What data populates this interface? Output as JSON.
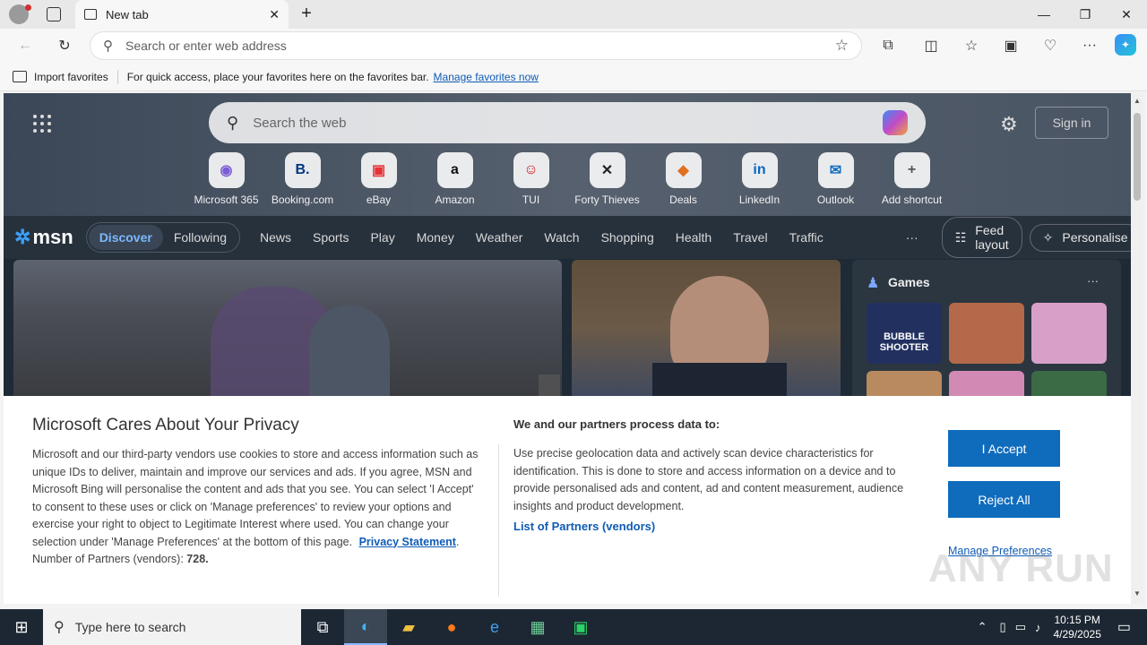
{
  "browser": {
    "tab_title": "New tab",
    "address_placeholder": "Search or enter web address",
    "favbar": {
      "import_label": "Import favorites",
      "hint": "For quick access, place your favorites here on the favorites bar.",
      "manage_link": "Manage favorites now"
    }
  },
  "msn": {
    "search_placeholder": "Search the web",
    "sign_in": "Sign in",
    "shortcuts": [
      {
        "label": "Microsoft 365",
        "icon": "microsoft-365-icon",
        "glyph": "◉",
        "color": "#7a5bd6"
      },
      {
        "label": "Booking.com",
        "icon": "booking-icon",
        "glyph": "B.",
        "color": "#003580"
      },
      {
        "label": "eBay",
        "icon": "ebay-icon",
        "glyph": "▣",
        "color": "#e53238"
      },
      {
        "label": "Amazon",
        "icon": "amazon-icon",
        "glyph": "a",
        "color": "#111111"
      },
      {
        "label": "TUI",
        "icon": "tui-icon",
        "glyph": "☺",
        "color": "#d40e14"
      },
      {
        "label": "Forty Thieves",
        "icon": "forty-thieves-icon",
        "glyph": "✕",
        "color": "#222222"
      },
      {
        "label": "Deals",
        "icon": "deals-icon",
        "glyph": "◆",
        "color": "#e07020"
      },
      {
        "label": "LinkedIn",
        "icon": "linkedin-icon",
        "glyph": "in",
        "color": "#0a66c2"
      },
      {
        "label": "Outlook",
        "icon": "outlook-icon",
        "glyph": "✉",
        "color": "#0f6cbd"
      },
      {
        "label": "Add shortcut",
        "icon": "plus-icon",
        "glyph": "+",
        "color": "#555555"
      }
    ],
    "logo": "msn",
    "nav": {
      "discover": "Discover",
      "following": "Following",
      "items": [
        "News",
        "Sports",
        "Play",
        "Money",
        "Weather",
        "Watch",
        "Shopping",
        "Health",
        "Travel",
        "Traffic"
      ],
      "more": "···",
      "feed_layout": "Feed layout",
      "personalise": "Personalise"
    },
    "games": {
      "title": "Games",
      "more": "···",
      "tile_text": "BUBBLE SHOOTER"
    }
  },
  "privacy": {
    "title": "Microsoft Cares About Your Privacy",
    "body": "Microsoft and our third-party vendors use cookies to store and access information such as unique IDs to deliver, maintain and improve our services and ads. If you agree, MSN and Microsoft Bing will personalise the content and ads that you see. You can select 'I Accept' to consent to these uses or click on 'Manage preferences' to review your options and exercise your right to object to Legitimate Interest where used.  You can change your selection under 'Manage Preferences' at the bottom of this page.",
    "privacy_link": "Privacy Statement",
    "partners_label": "Number of Partners (vendors):",
    "partners_count": "728.",
    "right_title": "We and our partners process data to:",
    "right_body": "Use precise geolocation data and actively scan device characteristics for identification. This is done to store and access information on a device and to provide personalised ads and content, ad and content measurement, audience insights and product development.",
    "partners_link": "List of Partners (vendors)",
    "accept": "I Accept",
    "reject": "Reject All",
    "manage": "Manage Preferences"
  },
  "taskbar": {
    "search_placeholder": "Type here to search",
    "time": "10:15 PM",
    "date": "4/29/2025"
  },
  "watermark": "ANY RUN"
}
